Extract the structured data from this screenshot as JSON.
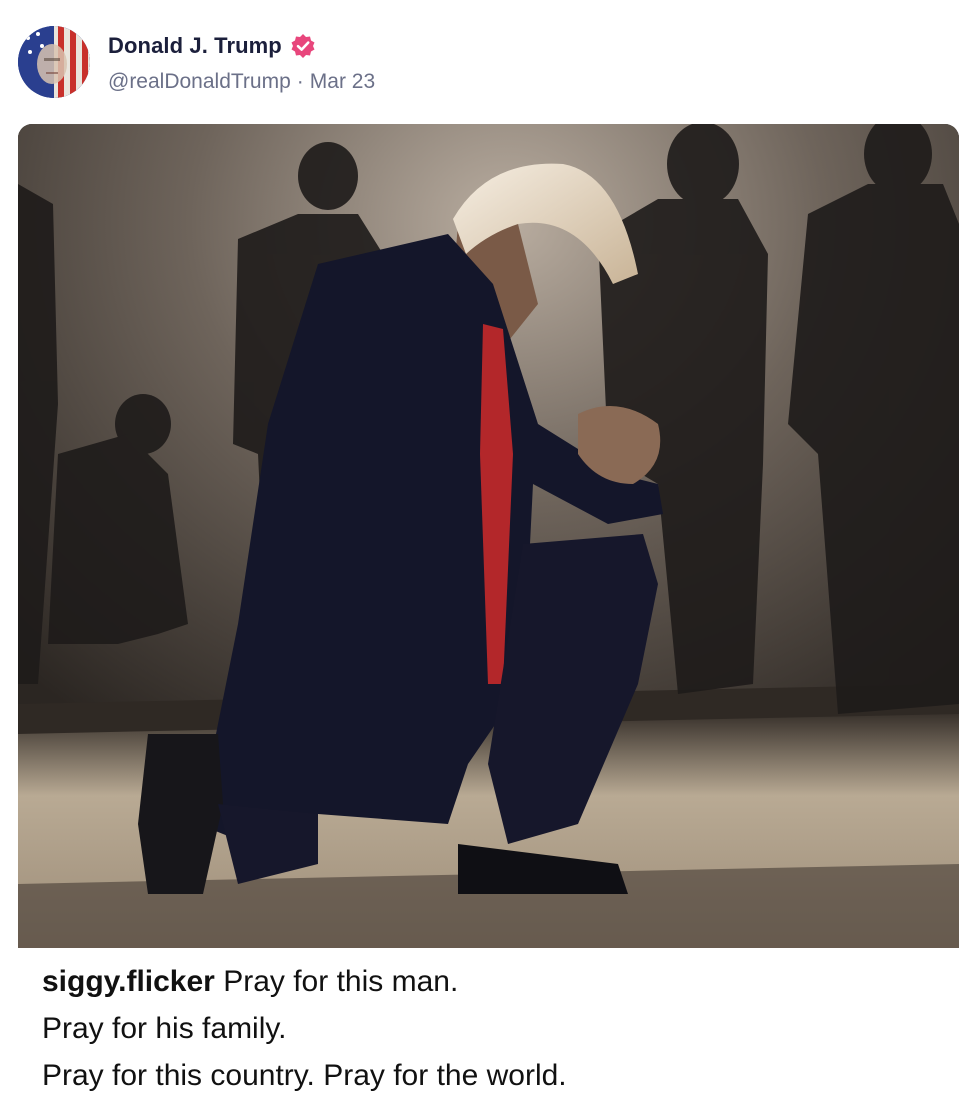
{
  "author": {
    "display_name": "Donald J. Trump",
    "handle": "@realDonaldTrump",
    "separator": "·",
    "date": "Mar 23",
    "verified_color": "#e8467c"
  },
  "avatar": {
    "icon": "flag-portrait-avatar"
  },
  "media": {
    "icon": "kneeling-man-photo"
  },
  "caption": {
    "username": "siggy.flicker",
    "line1": "Pray for this man.",
    "line2": "Pray for his family.",
    "line3": "Pray for this country.  Pray for the world."
  }
}
